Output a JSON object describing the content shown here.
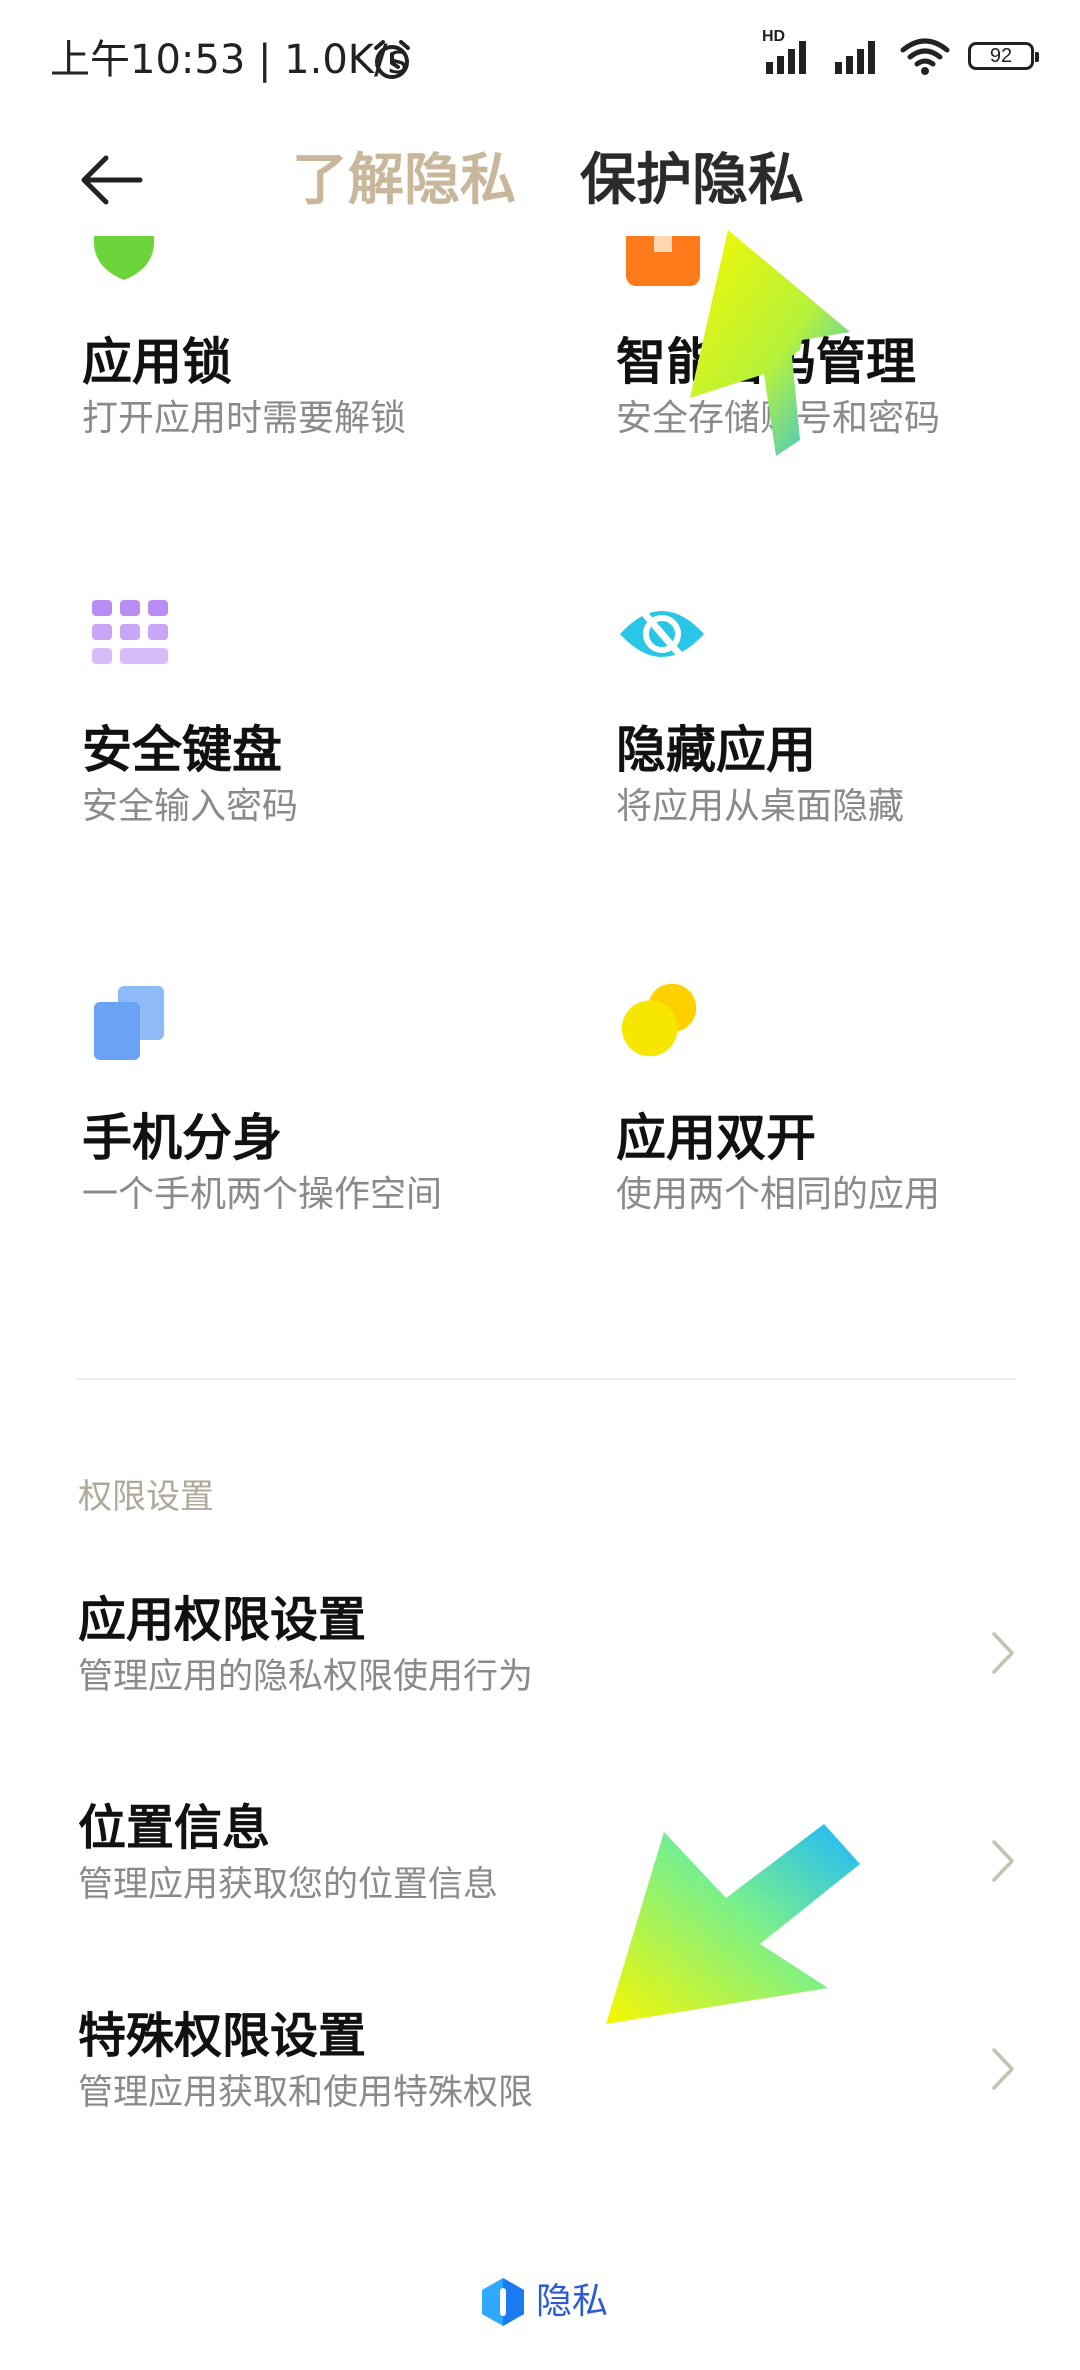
{
  "status_bar": {
    "time_text": "上午10:53 | 1.0K/s",
    "signal_label": "HD",
    "battery_level": "92",
    "icons": [
      "alarm-icon",
      "signal-hd-icon",
      "signal-icon",
      "wifi-icon",
      "battery-icon"
    ]
  },
  "header": {
    "back_icon": "back-arrow-icon",
    "tabs": [
      {
        "label": "了解隐私",
        "active": false
      },
      {
        "label": "保护隐私",
        "active": true
      }
    ]
  },
  "tiles": [
    {
      "title": "应用锁",
      "subtitle": "打开应用时需要解锁",
      "icon": "app-lock-icon",
      "color": "#6bd43a"
    },
    {
      "title": "智能密码管理",
      "subtitle": "安全存储账号和密码",
      "icon": "password-manager-icon",
      "color": "#ff7a1a"
    },
    {
      "title": "安全键盘",
      "subtitle": "安全输入密码",
      "icon": "keyboard-icon",
      "color": "#b98cf4"
    },
    {
      "title": "隐藏应用",
      "subtitle": "将应用从桌面隐藏",
      "icon": "hidden-eye-icon",
      "color": "#29c6e8"
    },
    {
      "title": "手机分身",
      "subtitle": "一个手机两个操作空间",
      "icon": "second-space-icon",
      "color": "#6aa3f5"
    },
    {
      "title": "应用双开",
      "subtitle": "使用两个相同的应用",
      "icon": "dual-apps-icon",
      "color": "#f6d800"
    }
  ],
  "section": {
    "title": "权限设置",
    "rows": [
      {
        "title": "应用权限设置",
        "subtitle": "管理应用的隐私权限使用行为"
      },
      {
        "title": "位置信息",
        "subtitle": "管理应用获取您的位置信息"
      },
      {
        "title": "特殊权限设置",
        "subtitle": "管理应用获取和使用特殊权限"
      }
    ]
  },
  "footer": {
    "label": "隐私",
    "icon": "privacy-logo-icon"
  },
  "colors": {
    "inactive_tab": "#c9b79b",
    "active_tab": "#2b2b2b",
    "subtitle": "#8a8a8a",
    "annotation_arrow_yellow": "#f7f700",
    "annotation_arrow_cyan": "#20d4ff"
  }
}
